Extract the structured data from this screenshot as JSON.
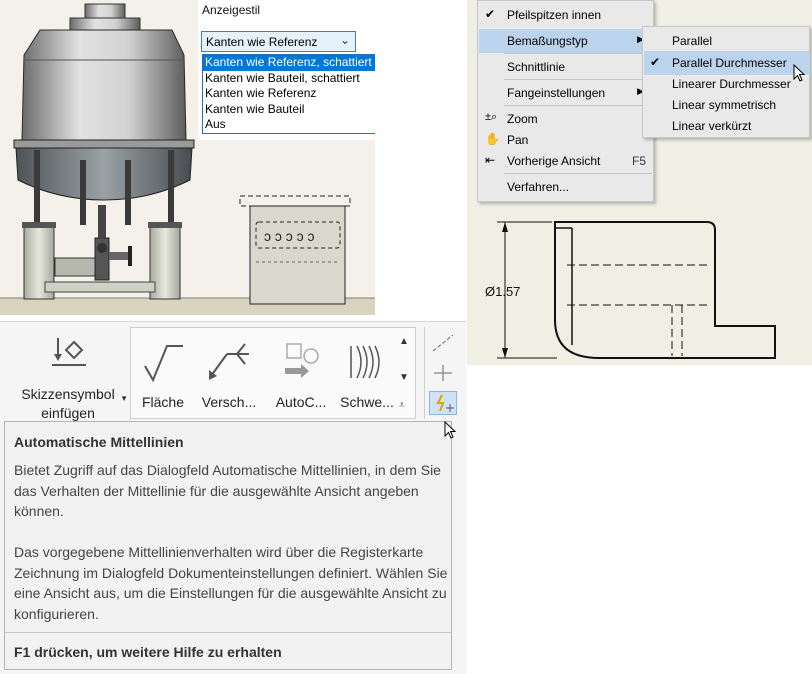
{
  "panel1": {
    "property_label": "Anzeigestil",
    "combo_value": "Kanten wie Referenz",
    "options": [
      "Kanten wie Referenz, schattiert",
      "Kanten wie Bauteil, schattiert",
      "Kanten wie Referenz",
      "Kanten wie Bauteil",
      "Aus"
    ],
    "selected_index": 0,
    "selection_color": "#0078d7"
  },
  "panel2": {
    "menu": [
      {
        "label": "Pfeilspitzen innen",
        "icon": "checkmark-icon"
      },
      {
        "label": "Bemaßungstyp",
        "icon": "",
        "submenu": true,
        "highlighted": true
      },
      {
        "label": "Schnittlinie",
        "icon": ""
      },
      {
        "label": "Fangeinstellungen",
        "icon": "",
        "submenu": true
      },
      {
        "label": "Zoom",
        "icon": "zoom-icon"
      },
      {
        "label": "Pan",
        "icon": "pan-hand-icon"
      },
      {
        "label": "Vorherige Ansicht",
        "icon": "previous-view-icon",
        "shortcut": "F5"
      },
      {
        "label": "Verfahren...",
        "icon": ""
      }
    ],
    "submenu": [
      {
        "label": "Parallel"
      },
      {
        "label": "Parallel Durchmesser",
        "checked": true,
        "highlighted": true
      },
      {
        "label": "Linearer Durchmesser"
      },
      {
        "label": "Linear symmetrisch"
      },
      {
        "label": "Linear verkürzt"
      }
    ],
    "dimension_text": "Ø1.57",
    "highlight_color": "#bcd3ee"
  },
  "panel3": {
    "sketch_button": "Skizzensymbol einfügen",
    "gallery": [
      "Fläche",
      "Versch...",
      "AutoC...",
      "Schwe..."
    ],
    "tooltip": {
      "title": "Automatische Mittellinien",
      "desc1": "Bietet Zugriff auf das Dialogfeld Automatische Mittellinien, in dem Sie das Verhalten der Mittellinie für die ausgewählte Ansicht angeben können.",
      "desc2": "Das vorgegebene Mittellinienverhalten wird über die Registerkarte Zeichnung im Dialogfeld Dokumenteinstellungen definiert. Wählen Sie eine Ansicht aus, um die Einstellungen für die ausgewählte Ansicht zu konfigurieren.",
      "footer": "F1 drücken, um weitere Hilfe zu erhalten"
    }
  }
}
